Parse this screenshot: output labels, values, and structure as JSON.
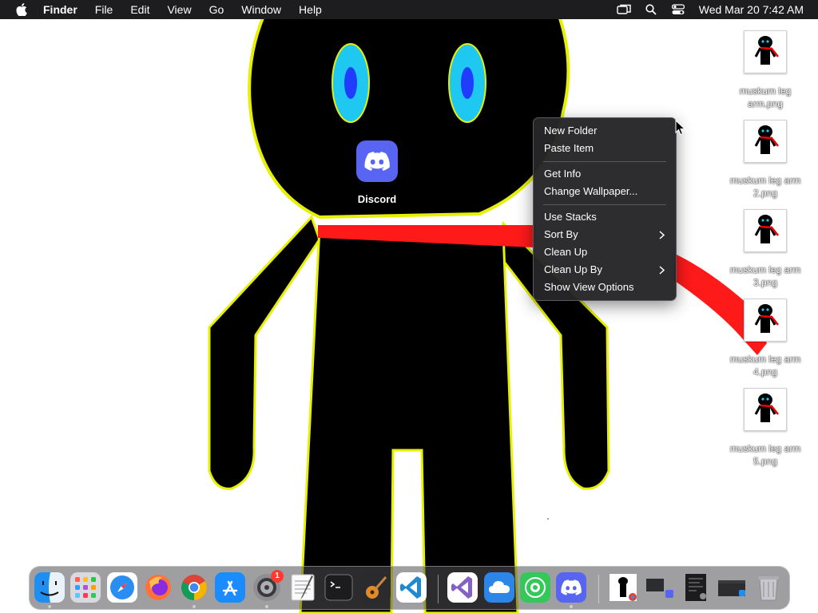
{
  "menubar": {
    "app_name": "Finder",
    "menus": [
      "File",
      "Edit",
      "View",
      "Go",
      "Window",
      "Help"
    ],
    "clock": "Wed Mar 20  7:42 AM",
    "status_icons": [
      "screen-mirroring-icon",
      "spotlight-search-icon",
      "control-center-icon"
    ]
  },
  "desktop": {
    "discord_label": "Discord",
    "files": [
      {
        "name": "muskum leg arm.png"
      },
      {
        "name": "muskum leg arm 2.png"
      },
      {
        "name": "muskum leg arm 3.png"
      },
      {
        "name": "muskum leg arm 4.png"
      },
      {
        "name": "muskum leg arm 5.png"
      }
    ]
  },
  "context_menu": {
    "items": [
      {
        "label": "New Folder"
      },
      {
        "label": "Paste Item"
      },
      {
        "label": "Get Info"
      },
      {
        "label": "Change Wallpaper..."
      },
      {
        "label": "Use Stacks"
      },
      {
        "label": "Sort By",
        "submenu": true
      },
      {
        "label": "Clean Up"
      },
      {
        "label": "Clean Up By",
        "submenu": true
      },
      {
        "label": "Show View Options"
      }
    ]
  },
  "dock": {
    "apps": [
      {
        "icon": "finder-icon",
        "running": true
      },
      {
        "icon": "launchpad-icon",
        "running": false
      },
      {
        "icon": "safari-icon",
        "running": false
      },
      {
        "icon": "firefox-icon",
        "running": false
      },
      {
        "icon": "chrome-icon",
        "running": true
      },
      {
        "icon": "app-store-icon",
        "running": false
      },
      {
        "icon": "system-settings-icon",
        "running": true,
        "badge": "1"
      },
      {
        "icon": "textedit-icon",
        "running": false
      },
      {
        "icon": "terminal-icon",
        "running": false
      },
      {
        "icon": "garageband-icon",
        "running": false
      },
      {
        "icon": "vscode-icon",
        "running": false
      },
      {
        "icon": "visual-studio-icon",
        "running": false
      },
      {
        "icon": "icloud-icon",
        "running": false
      },
      {
        "icon": "find-my-icon",
        "running": false
      },
      {
        "icon": "discord-icon",
        "running": true
      }
    ],
    "recent": [
      "image-preview-icon",
      "discord-window-preview-icon",
      "screenshot-window-preview-icon",
      "finder-window-preview-icon"
    ],
    "trash": "trash-icon"
  }
}
